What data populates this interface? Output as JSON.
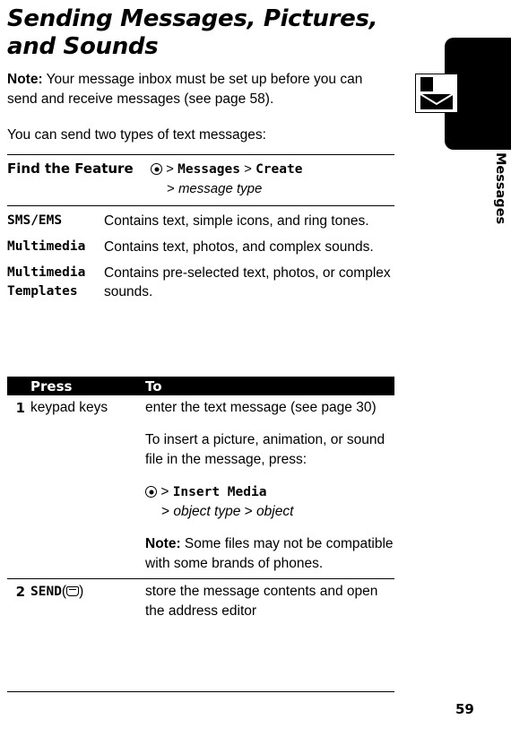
{
  "page": {
    "title": "Sending Messages, Pictures, and Sounds",
    "number": "59",
    "tab_label": "Messages",
    "tab_icon": "envelope-icon"
  },
  "paragraphs": {
    "note_label": "Note:",
    "note_text": " Your message inbox must be set up before you can send and receive messages (see page 58).",
    "intro": "You can send two types of text messages:"
  },
  "find_the_feature": {
    "label": "Find the Feature",
    "key_icon": "menu-key-icon",
    "nav_line1_sep1": ">",
    "nav_line1_item1": "Messages",
    "nav_line1_sep2": ">",
    "nav_line1_item2": "Create",
    "nav_line2_sep": ">",
    "nav_line2_item": "message type"
  },
  "message_types": [
    {
      "term": "SMS/EMS",
      "definition": "Contains text, simple icons, and ring tones."
    },
    {
      "term": "Multimedia",
      "definition": "Contains text, photos, and complex sounds."
    },
    {
      "term": "Multimedia Templates",
      "definition": "Contains pre-selected text, photos, or complex sounds."
    }
  ],
  "steps_table": {
    "headers": {
      "num": "",
      "press": "Press",
      "to": "To"
    },
    "rows": [
      {
        "num": "1",
        "press": "keypad keys",
        "to_paragraphs": [
          "enter the text message (see page 30)",
          "To insert a picture, animation, or sound file in the message, press:"
        ],
        "nav": {
          "key_icon": "menu-key-icon",
          "sep1": ">",
          "item1": "Insert Media",
          "sep2": ">",
          "item2": "object type",
          "sep3": ">",
          "item3": "object"
        },
        "note_label": "Note:",
        "note_text": " Some files may not be compatible with some brands of phones."
      },
      {
        "num": "2",
        "press_softkey": "SEND",
        "press_paren_open": "(",
        "press_key_icon": "soft-key-icon",
        "press_paren_close": ")",
        "to_paragraphs": [
          "store the message contents and open the address editor"
        ]
      }
    ]
  }
}
